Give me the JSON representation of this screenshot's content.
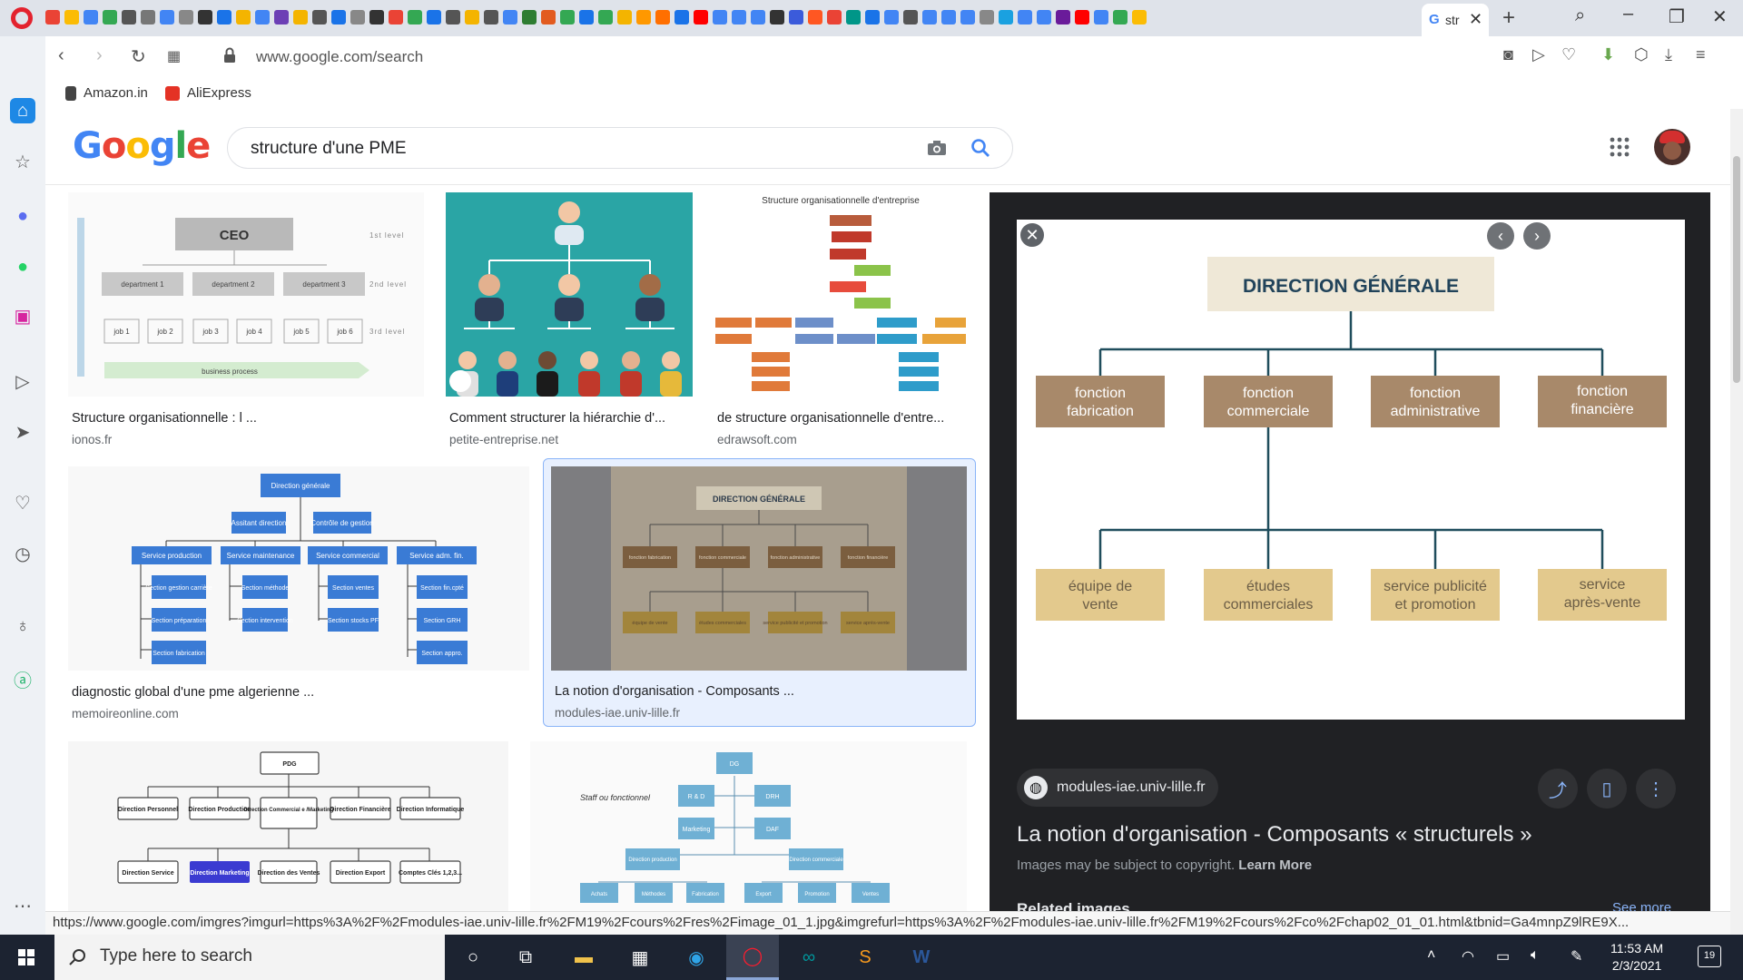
{
  "browser": {
    "active_tab_title": "str",
    "url": "www.google.com/search",
    "bookmarks": [
      "Amazon.in",
      "AliExpress"
    ],
    "favicon_colors": [
      "#ea4335",
      "#fbbc05",
      "#4285f4",
      "#34a853",
      "#555555",
      "#777777",
      "#4285f4",
      "#888888",
      "#333333",
      "#1a73e8",
      "#f4b400",
      "#4285f4",
      "#6c3fb5",
      "#f4b400",
      "#555555",
      "#1a73e8",
      "#888888",
      "#333333",
      "#ea4335",
      "#34a853",
      "#1a73e8",
      "#555555",
      "#f4b400",
      "#555555",
      "#4285f4",
      "#2e7d32",
      "#e25b1f",
      "#34a853",
      "#1a73e8",
      "#34a853",
      "#f4b400",
      "#ff9800",
      "#ff6f00",
      "#1a73e8",
      "#ff0000",
      "#4285f4",
      "#4285f4",
      "#4285f4",
      "#333333",
      "#3b5bdb",
      "#ff5722",
      "#ea4335",
      "#009688",
      "#1a73e8",
      "#4285f4",
      "#555555",
      "#4285f4",
      "#4285f4",
      "#4285f4",
      "#888888",
      "#1aa1e0",
      "#4285f4",
      "#4285f4",
      "#6a1b9a",
      "#ff0000",
      "#4285f4",
      "#34a853",
      "#fbbc05"
    ]
  },
  "google": {
    "logo": "Google",
    "query": "structure d'une PME"
  },
  "results": [
    {
      "title": "Structure organisationnelle : l ...",
      "source": "ionos.fr"
    },
    {
      "title": "Comment structurer la hiérarchie d'...",
      "source": "petite-entreprise.net"
    },
    {
      "title": "de structure organisationnelle d'entre...",
      "source": "edrawsoft.com"
    },
    {
      "title": "diagnostic global d'une pme algerienne ...",
      "source": "memoireonline.com"
    },
    {
      "title": "La notion d'organisation - Composants ...",
      "source": "modules-iae.univ-lille.fr"
    }
  ],
  "thumbs": {
    "ionos": {
      "ceo": "CEO",
      "departments": [
        "department 1",
        "department 2",
        "department 3"
      ],
      "jobs": [
        "job 1",
        "job 2",
        "job 3",
        "job 4",
        "job 5",
        "job 6"
      ],
      "levels": [
        "1st level",
        "2nd level",
        "3rd level"
      ],
      "process": "business process"
    },
    "edraw": {
      "title": "Structure organisationnelle d'entreprise"
    },
    "memoire": {
      "top": "Direction générale",
      "assistant": "Assitant direction",
      "control": "Contrôle de gestion",
      "services": [
        "Service production",
        "Service maintenance",
        "Service commercial",
        "Service adm. fin."
      ],
      "sub1": [
        "Section gestion carrière",
        "Section préparation",
        "Section fabrication"
      ],
      "sub2": [
        "Section méthode",
        "Section intervention"
      ],
      "sub3": [
        "Section ventes",
        "Section stocks PF"
      ],
      "sub4": [
        "Section fin.cpté",
        "Section GRH",
        "Section appro."
      ]
    },
    "lille": {
      "top": "DIRECTION GÉNÉRALE",
      "row1": [
        "fonction fabrication",
        "fonction commerciale",
        "fonction administrative",
        "fonction financière"
      ],
      "row2": [
        "équipe de vente",
        "études commerciales",
        "service publicité et promotion",
        "service après-vente"
      ]
    },
    "pdg": {
      "top": "PDG",
      "row1": [
        "Direction Personnel",
        "Direction Production",
        "Direction Commercial e /Marketing",
        "Direction Financière",
        "Direction Informatique"
      ],
      "row2": [
        "Direction Service",
        "Direction Marketing",
        "Direction des Ventes",
        "Direction Export",
        "Comptes Clés 1,2,3..."
      ]
    },
    "dg": {
      "top": "DG",
      "staff": "Staff ou fonctionnel",
      "row1": [
        "R & D",
        "DRH"
      ],
      "row2": [
        "Marketing",
        "DAF"
      ],
      "row3": [
        "Direction production",
        "Direction commerciale"
      ],
      "row4": [
        "Achats",
        "Méthodes",
        "Fabrication",
        "Export",
        "Promotion",
        "Ventes"
      ]
    }
  },
  "preview": {
    "chart_top": "DIRECTION GÉNÉRALE",
    "row1": [
      "fonction fabrication",
      "fonction commerciale",
      "fonction administrative",
      "fonction financière"
    ],
    "row2": [
      "équipe de vente",
      "études commerciales",
      "service publicité et promotion",
      "service après-vente"
    ],
    "site": "modules-iae.univ-lille.fr",
    "title": "La notion d'organisation - Composants « structurels »",
    "copyright": "Images may be subject to copyright.",
    "learn_more": "Learn More",
    "related": "Related images",
    "see_more": "See more"
  },
  "status_url": "https://www.google.com/imgres?imgurl=https%3A%2F%2Fmodules-iae.univ-lille.fr%2FM19%2Fcours%2Fres%2Fimage_01_1.jpg&imgrefurl=https%3A%2F%2Fmodules-iae.univ-lille.fr%2FM19%2Fcours%2Fco%2Fchap02_01_01.html&tbnid=Ga4mnpZ9lRE9X...",
  "taskbar": {
    "search_placeholder": "Type here to search",
    "time": "11:53 AM",
    "date": "2/3/2021",
    "notifications": "19"
  }
}
